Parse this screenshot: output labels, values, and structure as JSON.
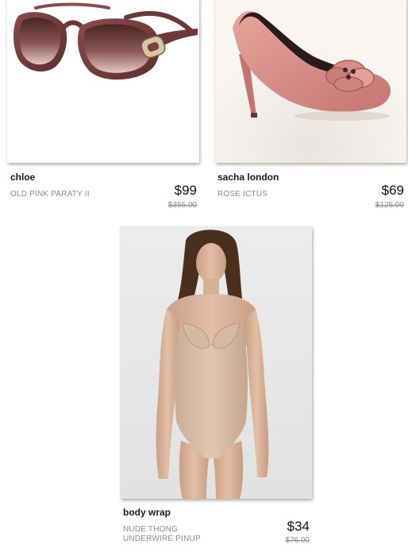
{
  "products": [
    {
      "brand": "chloe",
      "description": "OLD PINK PARATY II",
      "price": "$99",
      "original_price": "$355.00",
      "image_icon": "sunglasses-image"
    },
    {
      "brand": "sacha london",
      "description": "ROSE ICTUS",
      "price": "$69",
      "original_price": "$125.00",
      "image_icon": "pump-shoe-image"
    },
    {
      "brand": "body wrap",
      "description_lines": [
        "NUDE THONG",
        "UNDERWIRE PINUP"
      ],
      "price": "$34",
      "original_price": "$76.00",
      "image_icon": "bodysuit-model-image"
    }
  ],
  "colors": {
    "frame_brown": "#7a3f3f",
    "lens_gradient_top": "#5b2c2c",
    "shoe_pink": "#d98f8a",
    "skin": "#d9b39a",
    "bodysuit_nude": "#d8bca5"
  }
}
